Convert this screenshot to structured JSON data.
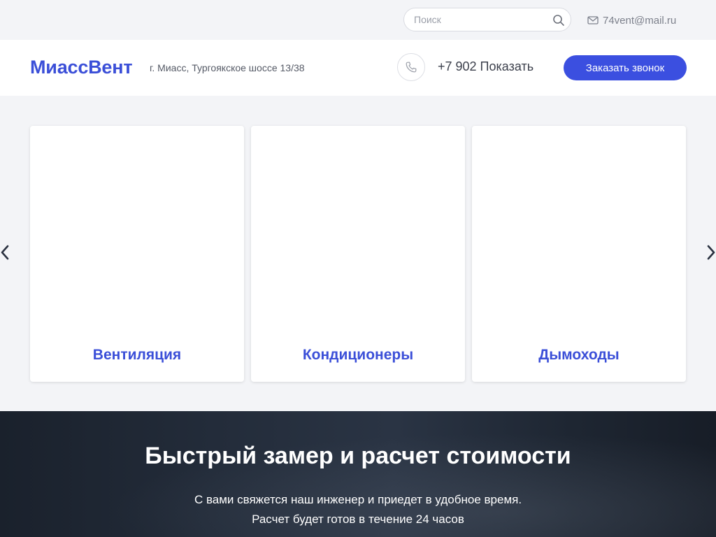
{
  "topbar": {
    "search": {
      "placeholder": "Поиск",
      "value": "",
      "icon": "search-icon"
    },
    "email": {
      "icon": "envelope-icon",
      "text": "74vent@mail.ru"
    }
  },
  "header": {
    "logo": "МиассВент",
    "address": "г. Миасс, Тургоякское шоссе 13/38",
    "phone": {
      "icon": "phone-icon",
      "text": "+7 902 Показать"
    },
    "callback_button": "Заказать звонок"
  },
  "slider": {
    "prev_icon": "chevron-left-icon",
    "next_icon": "chevron-right-icon",
    "cards": [
      {
        "title": "Вентиляция"
      },
      {
        "title": "Кондиционеры"
      },
      {
        "title": "Дымоходы"
      }
    ]
  },
  "promo": {
    "title": "Быстрый замер и расчет стоимости",
    "line1": "С вами свяжется наш инженер и приедет в удобное время.",
    "line2": "Расчет будет готов в течение 24 часов"
  },
  "colors": {
    "accent": "#3b4fd8",
    "button": "#3b4fe0",
    "page_bg": "#f3f4f7",
    "promo_bg": "#1e2632"
  }
}
